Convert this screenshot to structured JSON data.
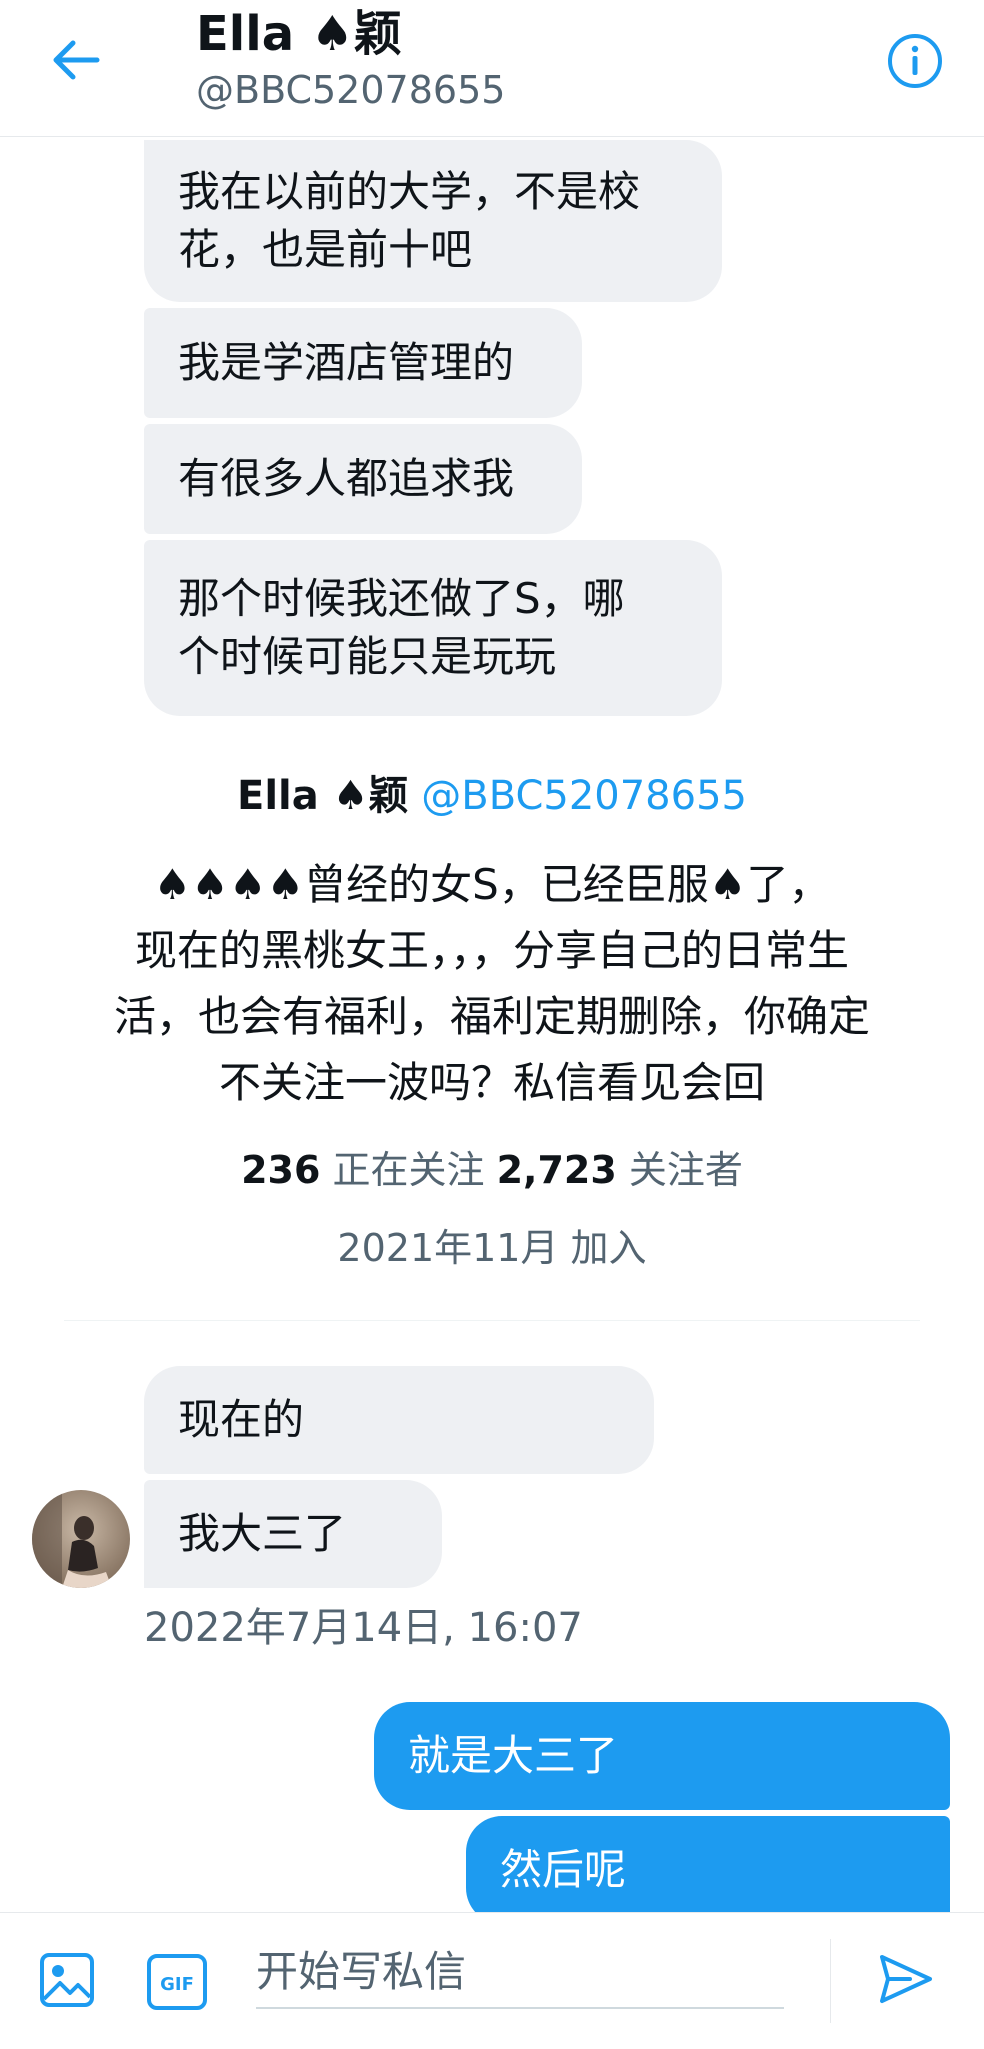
{
  "header": {
    "name": "Ella ♠颖",
    "handle": "@BBC52078655"
  },
  "received_messages_top": [
    {
      "lines": [
        "我在以前的大学，不是校",
        "花，也是前十吧"
      ]
    },
    {
      "lines": [
        "我是学酒店管理的"
      ]
    },
    {
      "lines": [
        "有很多人都追求我"
      ]
    },
    {
      "lines": [
        "那个时候我还做了S，哪",
        "个时候可能只是玩玩"
      ]
    }
  ],
  "profile_card": {
    "name": "Ella ♠颖",
    "handle": "@BBC52078655",
    "bio_lines": [
      "♠♠♠♠曾经的女S，已经臣服♠了，",
      "现在的黑桃女王，，，分享自己的日常生",
      "活，也会有福利，福利定期删除，你确定",
      "不关注一波吗？私信看见会回"
    ],
    "following_count": "236",
    "following_label": "正在关注",
    "followers_count": "2,723",
    "followers_label": "关注者",
    "joined": "2021年11月 加入"
  },
  "received_messages_bottom": [
    {
      "lines": [
        "现在的"
      ]
    },
    {
      "lines": [
        "我大三了"
      ]
    }
  ],
  "timestamp": "2022年7月14日, 16:07",
  "sent_messages": [
    {
      "lines": [
        "就是大三了"
      ]
    },
    {
      "lines": [
        "然后呢"
      ]
    }
  ],
  "composer": {
    "placeholder": "开始写私信",
    "gif_label": "GIF"
  },
  "icons": {
    "back": "back-arrow-icon",
    "info": "info-icon",
    "media": "image-icon",
    "gif": "gif-icon",
    "send": "send-icon"
  },
  "colors": {
    "accent": "#1d9bf0",
    "received_bubble": "#eef0f3",
    "secondary_text": "#536471"
  }
}
